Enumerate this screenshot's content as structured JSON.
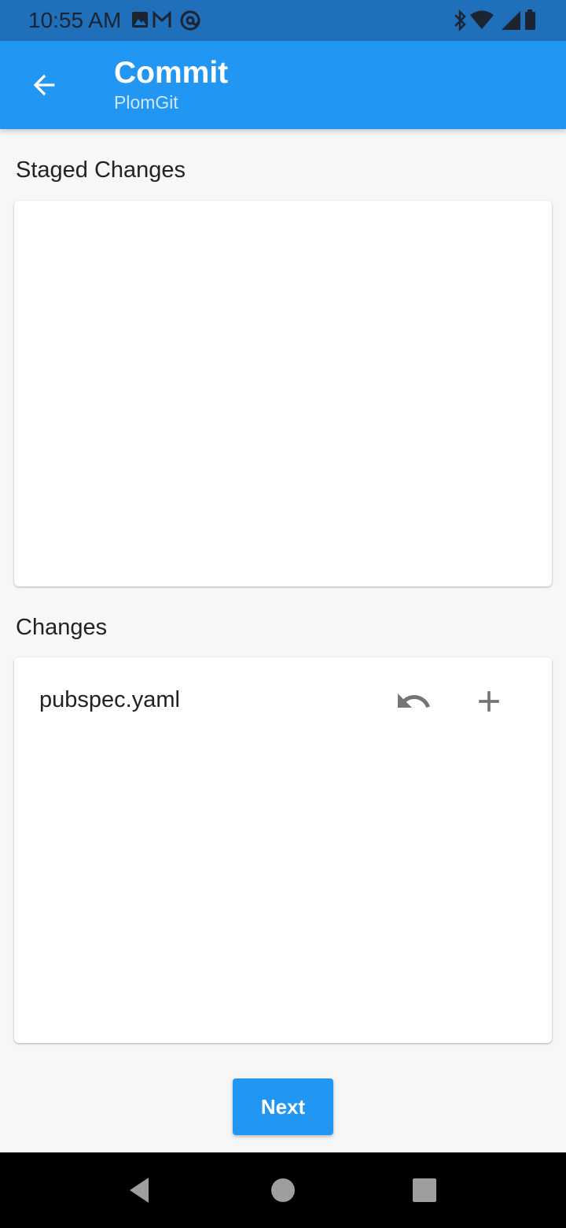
{
  "status_bar": {
    "time": "10:55 AM",
    "left_icons": [
      "image-icon",
      "gmail-icon",
      "at-sign-icon"
    ],
    "right_icons": [
      "bluetooth-icon",
      "wifi-icon",
      "cellular-signal-icon",
      "battery-icon"
    ],
    "background_color": "#1f6fbb"
  },
  "app_bar": {
    "title": "Commit",
    "subtitle": "PlomGit",
    "back_icon": "arrow-back-icon",
    "background_color": "#2196f3"
  },
  "staged_section": {
    "title": "Staged Changes",
    "items": []
  },
  "changes_section": {
    "title": "Changes",
    "items": [
      {
        "file": "pubspec.yaml",
        "actions": [
          "undo-icon",
          "add-icon"
        ]
      }
    ]
  },
  "next_button": {
    "label": "Next",
    "color": "#2196f3"
  },
  "nav_bar": {
    "icons": [
      "back-triangle-icon",
      "home-circle-icon",
      "recents-square-icon"
    ]
  }
}
